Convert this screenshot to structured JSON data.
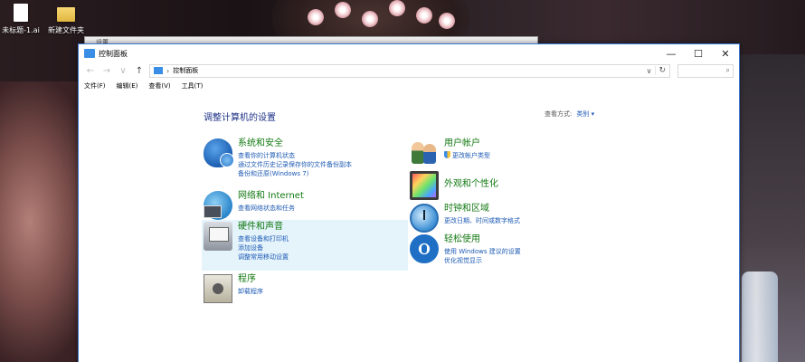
{
  "desktop": {
    "icons": [
      {
        "label": "未标题-1.ai",
        "icon": "document-icon"
      },
      {
        "label": "新建文件夹",
        "icon": "folder-icon"
      }
    ]
  },
  "back_window": {
    "title": "设置"
  },
  "window": {
    "title": "控制面板",
    "buttons": {
      "minimize": "—",
      "maximize": "☐",
      "close": "✕"
    }
  },
  "address": {
    "back": "←",
    "forward": "→",
    "history": "∨",
    "up": "↑",
    "separator": "›",
    "path": "控制面板",
    "dropdown": "∨",
    "refresh": "↻",
    "search_icon": "⌕"
  },
  "menu": [
    "文件(F)",
    "编辑(E)",
    "查看(V)",
    "工具(T)"
  ],
  "heading": "调整计算机的设置",
  "view_by": {
    "label": "查看方式:",
    "value": "类别 ▾"
  },
  "categories": [
    {
      "title": "系统和安全",
      "icon": "shield-icon",
      "links": [
        "查看你的计算机状态",
        "通过文件历史记录保存你的文件备份副本",
        "备份和还原(Windows 7)"
      ]
    },
    {
      "title": "网络和 Internet",
      "icon": "network-globe-icon",
      "links": [
        "查看网络状态和任务"
      ]
    },
    {
      "title": "硬件和声音",
      "icon": "printer-icon",
      "links": [
        "查看设备和打印机",
        "添加设备",
        "调整常用移动设置"
      ]
    },
    {
      "title": "程序",
      "icon": "programs-disc-icon",
      "links": [
        "卸载程序"
      ]
    },
    {
      "title": "用户帐户",
      "icon": "users-icon",
      "links": [
        "更改帐户类型"
      ]
    },
    {
      "title": "外观和个性化",
      "icon": "monitor-icon",
      "links": []
    },
    {
      "title": "时钟和区域",
      "icon": "clock-globe-icon",
      "links": [
        "更改日期、时间或数字格式"
      ]
    },
    {
      "title": "轻松使用",
      "icon": "ease-of-access-icon",
      "links": [
        "使用 Windows 建议的设置",
        "优化视觉显示"
      ]
    }
  ]
}
